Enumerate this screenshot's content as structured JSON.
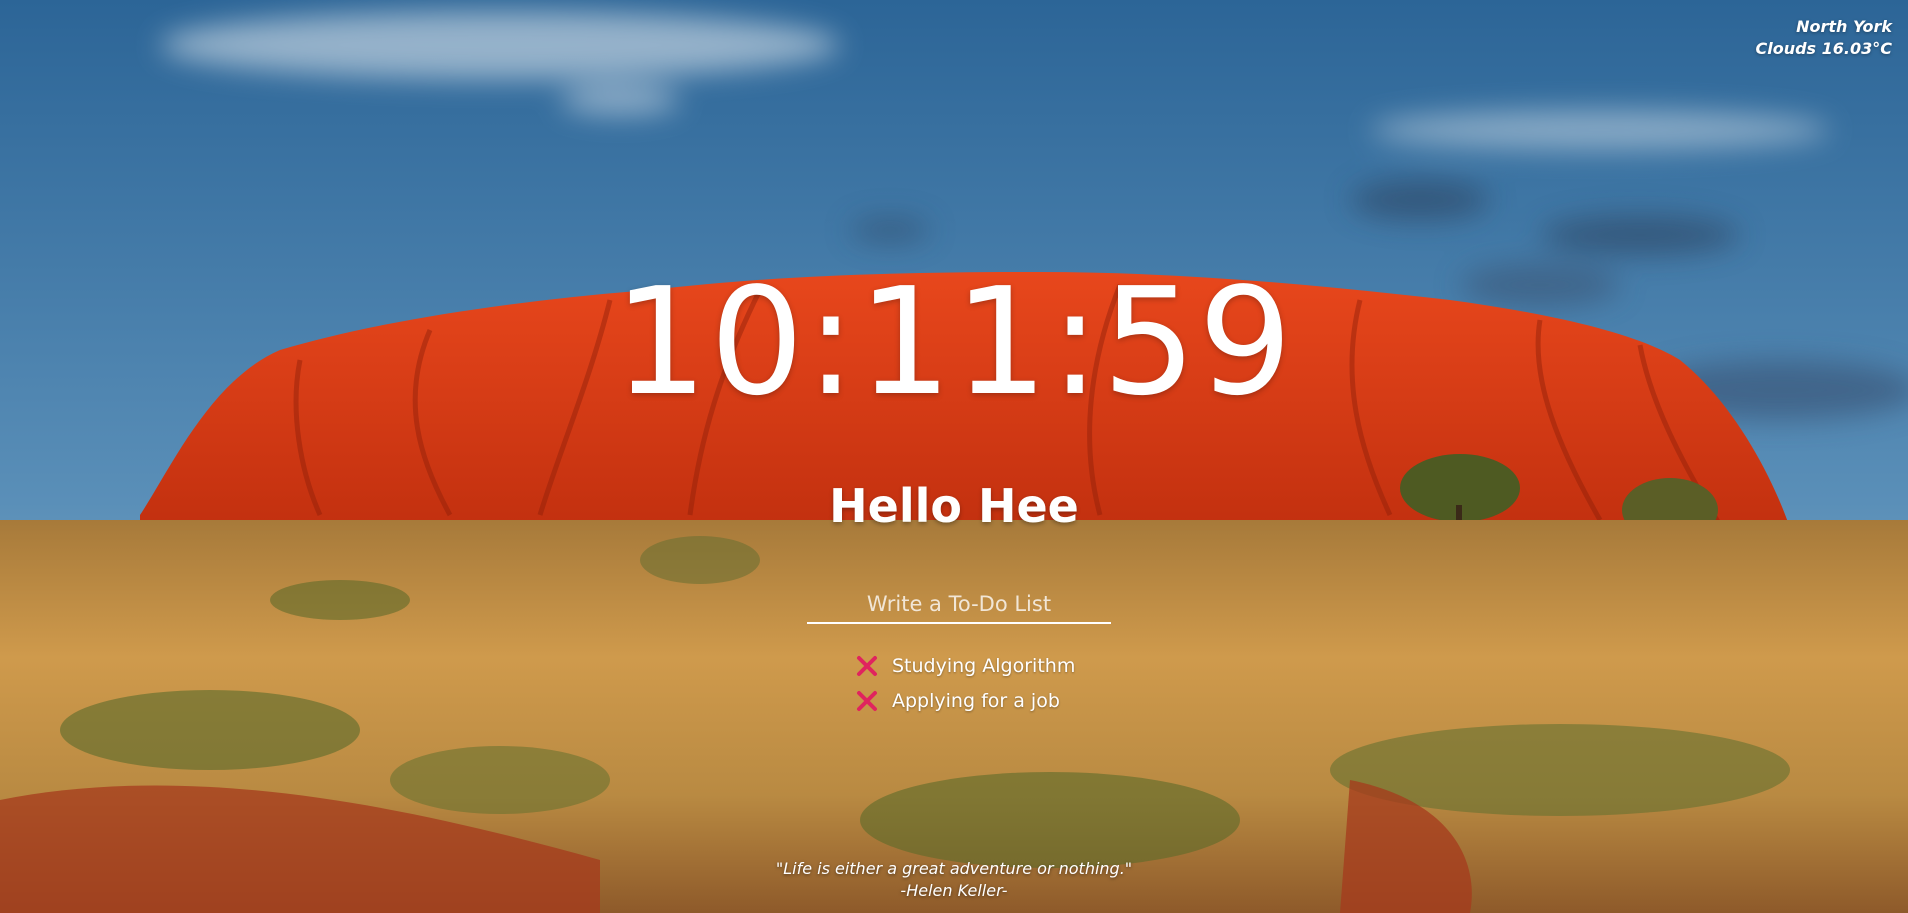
{
  "background": {
    "icon": "landscape-image",
    "colors": {
      "sky_top": "#2f6a9c",
      "sky_bottom": "#8fb3cc",
      "rock": "#e0401a",
      "grass": "#c08a3a",
      "soil": "#a83a1e"
    }
  },
  "weather": {
    "city": "North York",
    "condition": "Clouds 16.03°C"
  },
  "clock": {
    "time": "10:11:59"
  },
  "greeting": {
    "text": "Hello Hee"
  },
  "todo": {
    "placeholder": "Write a To-Do List",
    "value": "",
    "delete_icon": "close-icon",
    "delete_color": "#e0245e",
    "items": [
      {
        "label": "Studying Algorithm"
      },
      {
        "label": "Applying for a job"
      }
    ]
  },
  "quote": {
    "text": "\"Life is either a great adventure or nothing.\"",
    "author": "-Helen Keller-"
  }
}
